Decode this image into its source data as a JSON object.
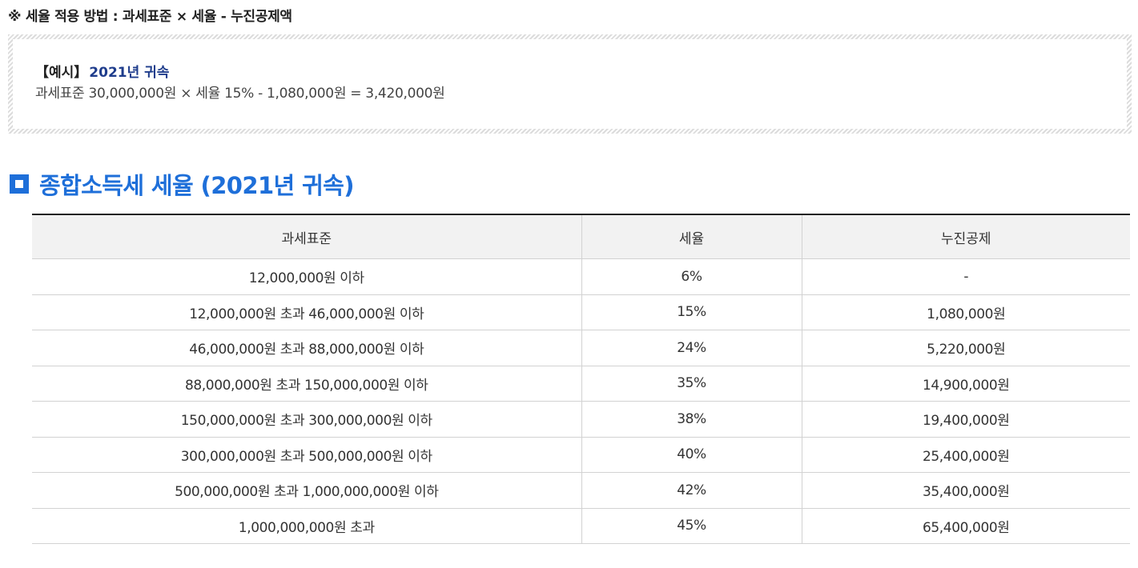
{
  "formula_note": "※ 세율 적용 방법 : 과세표준 × 세율 - 누진공제액",
  "example": {
    "bracket_label": "【예시】",
    "year_label": "2021년 귀속",
    "calculation": "과세표준 30,000,000원 × 세율 15% - 1,080,000원 = 3,420,000원"
  },
  "section": {
    "title": "종합소득세 세율 (2021년 귀속)"
  },
  "table": {
    "headers": [
      "과세표준",
      "세율",
      "누진공제"
    ],
    "rows": [
      [
        "12,000,000원 이하",
        "6%",
        "-"
      ],
      [
        "12,000,000원 초과 46,000,000원 이하",
        "15%",
        "1,080,000원"
      ],
      [
        "46,000,000원 초과 88,000,000원 이하",
        "24%",
        "5,220,000원"
      ],
      [
        "88,000,000원 초과 150,000,000원 이하",
        "35%",
        "14,900,000원"
      ],
      [
        "150,000,000원 초과 300,000,000원 이하",
        "38%",
        "19,400,000원"
      ],
      [
        "300,000,000원 초과 500,000,000원 이하",
        "40%",
        "25,400,000원"
      ],
      [
        "500,000,000원 초과 1,000,000,000원 이하",
        "42%",
        "35,400,000원"
      ],
      [
        "1,000,000,000원 초과",
        "45%",
        "65,400,000원"
      ]
    ]
  },
  "colors": {
    "accent_blue": "#1e6fd9",
    "example_year_blue": "#1f3d8c",
    "header_bg": "#f2f2f2"
  }
}
